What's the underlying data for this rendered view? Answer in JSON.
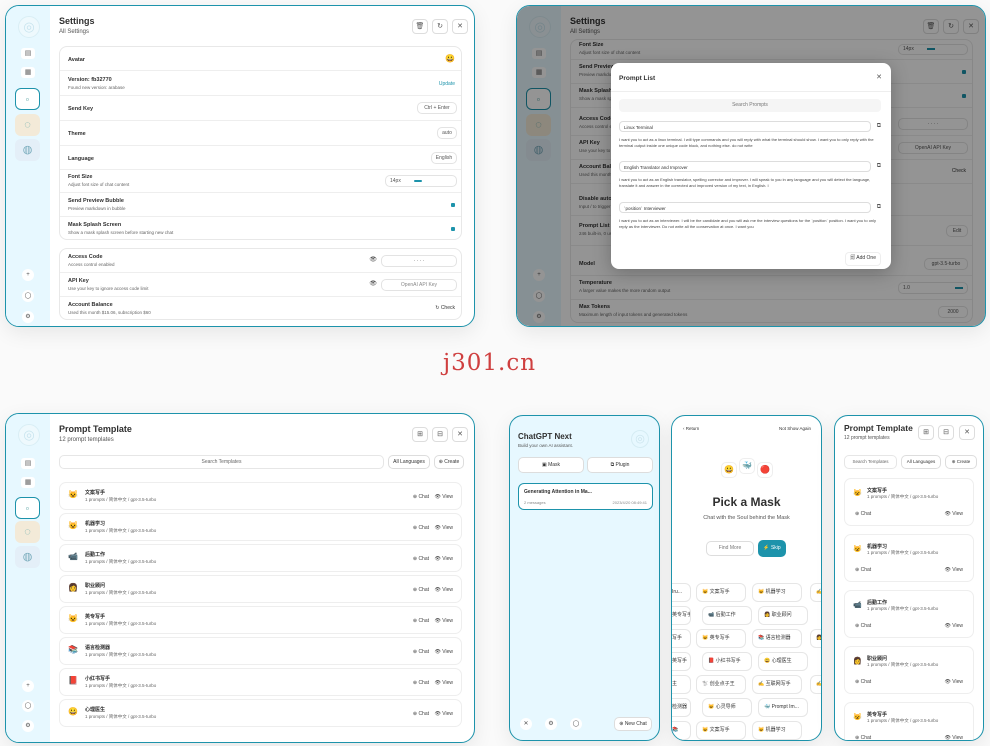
{
  "watermark": "j301.cn",
  "colors": {
    "accent": "#1d93ab",
    "sidebar": "#e7f8ff"
  },
  "settings": {
    "title": "Settings",
    "subtitle": "All Settings",
    "avatar": {
      "label": "Avatar",
      "value": "😀"
    },
    "version": {
      "label": "Version: fb32770",
      "sub": "Found new version: arabase",
      "action": "Update"
    },
    "send_key": {
      "label": "Send Key",
      "value": "Ctrl + Enter"
    },
    "theme": {
      "label": "Theme",
      "value": "auto"
    },
    "language": {
      "label": "Language",
      "value": "English"
    },
    "font_size": {
      "label": "Font Size",
      "sub": "Adjust font size of chat content",
      "value": "14px",
      "level": 0.3
    },
    "preview": {
      "label": "Send Preview Bubble",
      "sub": "Preview markdown in bubble"
    },
    "splash": {
      "label": "Mask Splash Screen",
      "sub": "Show a mask splash screen before starting new chat"
    },
    "access": {
      "label": "Access Code",
      "sub": "Access control enabled",
      "value": "· · · ·"
    },
    "api": {
      "label": "API Key",
      "sub": "Use your key to ignore access code limit",
      "placeholder": "OpenAI API Key"
    },
    "balance": {
      "label": "Account Balance",
      "sub": "Used this month $15.06, subscription $60",
      "action": "Check"
    }
  },
  "settings_bg": {
    "title": "Settings",
    "subtitle": "All Settings",
    "rows": [
      {
        "label": "Font Size",
        "sub": "Adjust font size of chat content",
        "value": "14px"
      },
      {
        "label": "Send Preview Bubble",
        "sub": "Preview markdown in bubble"
      },
      {
        "label": "Mask Splash Screen",
        "sub": "Show a mask splash screen before starting new chat"
      },
      {
        "label": "Access Code",
        "sub": "Access control enabled",
        "value": "· · · ·"
      },
      {
        "label": "API Key",
        "sub": "Use your key to ignore access code limit",
        "value": "OpenAI API Key"
      },
      {
        "label": "Account Balance",
        "sub": "Used this month",
        "value": "Check"
      },
      {
        "label": "Disable auto-completion",
        "sub": "Input / to trigger auto-completion"
      },
      {
        "label": "Prompt List",
        "sub": "246 built-in, 0 user-defined",
        "value": "Edit"
      },
      {
        "label": "Model",
        "value": "gpt-3.5-turbo"
      },
      {
        "label": "Temperature",
        "sub": "A larger value makes the more random output",
        "value": "1.0"
      },
      {
        "label": "Max Tokens",
        "sub": "Maximum length of input tokens and generated tokens",
        "value": "2000"
      }
    ],
    "modal": {
      "title": "Prompt List",
      "search": "Search Prompts",
      "add": "Add One",
      "items": [
        {
          "name": "Linux Terminal",
          "text": "I want you to act as a linux terminal. I will type commands and you will reply with what the terminal should show. I want you to only reply with the terminal output inside one unique code block, and nothing else. do not write"
        },
        {
          "name": "English Translator and Improver",
          "text": "I want you to act as an English translator, spelling corrector and improver. I will speak to you in any language and you will detect the language, translate it and answer in the corrected and improved version of my text, in English. I"
        },
        {
          "name": "`position` Interviewer",
          "text": "I want you to act as an interviewer. I will be the candidate and you will ask me the interview questions for the `position` position. I want you to only reply as the interviewer. Do not write all the conservation at once. I want you"
        }
      ]
    }
  },
  "templates": {
    "title": "Prompt Template",
    "subtitle": "12 prompt templates",
    "search": "Search Templates",
    "lang": "All Languages",
    "create": "Create",
    "chat": "Chat",
    "view": "View",
    "items": [
      {
        "emoji": "😺",
        "name": "文案写手",
        "sub": "1 prompts / 简体中文 / gpt-3.5-turbo"
      },
      {
        "emoji": "😺",
        "name": "机器学习",
        "sub": "1 prompts / 简体中文 / gpt-3.5-turbo"
      },
      {
        "emoji": "📹",
        "name": "后勤工作",
        "sub": "1 prompts / 简体中文 / gpt-3.5-turbo"
      },
      {
        "emoji": "👩",
        "name": "职业顾问",
        "sub": "1 prompts / 简体中文 / gpt-3.5-turbo"
      },
      {
        "emoji": "😺",
        "name": "英专写手",
        "sub": "1 prompts / 简体中文 / gpt-3.5-turbo"
      },
      {
        "emoji": "📚",
        "name": "语言检测器",
        "sub": "1 prompts / 简体中文 / gpt-3.5-turbo"
      },
      {
        "emoji": "📕",
        "name": "小红书写手",
        "sub": "1 prompts / 简体中文 / gpt-3.5-turbo"
      },
      {
        "emoji": "😀",
        "name": "心理医生",
        "sub": "1 prompts / 简体中文 / gpt-3.5-turbo"
      }
    ]
  },
  "mobile_side": {
    "title": "ChatGPT Next",
    "subtitle": "Build your own AI assistant.",
    "mask": "Mask",
    "plugin": "Plugin",
    "chat_title": "Generating Attention in Ma...",
    "chat_count": "2 messages",
    "chat_time": "2023/4/20 08:49:41",
    "new_chat": "New Chat"
  },
  "mobile_mask": {
    "back": "Return",
    "no_show": "Not Show Again",
    "emojis": [
      "😀",
      "🐳",
      "🔴"
    ],
    "title": "Pick a Mask",
    "subtitle": "Chat with the Soul behind the Mask",
    "find": "Find More",
    "skip": "Skip",
    "tiles": [
      {
        "text": "Iru..."
      },
      {
        "text": "😺 文案写手"
      },
      {
        "text": "😺 机器学习"
      },
      {
        "text": "✍️"
      },
      {
        "text": "英专写手"
      },
      {
        "text": "📹 后勤工作"
      },
      {
        "text": "👩 职业顾问"
      },
      {
        "text": "写手"
      },
      {
        "text": "😺 英专写手"
      },
      {
        "text": "📚 语言检测器"
      },
      {
        "text": "👩"
      },
      {
        "text": "英写手"
      },
      {
        "text": "📕 小红书写手"
      },
      {
        "text": "😀 心理医生"
      },
      {
        "text": "主"
      },
      {
        "text": "🐩 创业点子王"
      },
      {
        "text": "✍️ 互联网写手"
      },
      {
        "text": "✍️"
      },
      {
        "text": "检测器"
      },
      {
        "text": "😺 心灵导师"
      },
      {
        "text": "🐳 Prompt Im..."
      },
      {
        "text": "📚"
      },
      {
        "text": "😺 文案写手"
      },
      {
        "text": "😺 机器学习"
      }
    ]
  },
  "mobile_templates": {
    "title": "Prompt Template",
    "subtitle": "12 prompt templates",
    "search": "Search Templates",
    "lang": "All Languages",
    "create": "Create",
    "chat": "Chat",
    "view": "View",
    "items": [
      {
        "emoji": "😺",
        "name": "文案写手",
        "sub": "1 prompts / 简体中文 / gpt-3.5-turbo"
      },
      {
        "emoji": "😺",
        "name": "机器学习",
        "sub": "1 prompts / 简体中文 / gpt-3.5-turbo"
      },
      {
        "emoji": "📹",
        "name": "后勤工作",
        "sub": "1 prompts / 简体中文 / gpt-3.5-turbo"
      },
      {
        "emoji": "👩",
        "name": "职业顾问",
        "sub": "1 prompts / 简体中文 / gpt-3.5-turbo"
      },
      {
        "emoji": "😺",
        "name": "英专写手",
        "sub": "1 prompts / 简体中文 / gpt-3.5-turbo"
      }
    ]
  }
}
